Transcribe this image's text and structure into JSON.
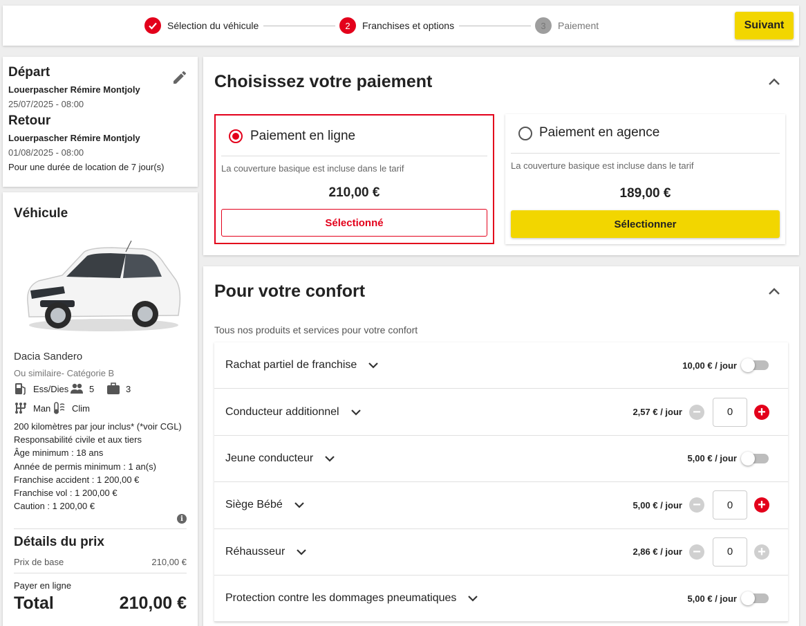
{
  "stepper": {
    "steps": [
      {
        "label": "Sélection du véhicule",
        "state": "done",
        "number": "✓"
      },
      {
        "label": "Franchises et options",
        "state": "active",
        "number": "2"
      },
      {
        "label": "Paiement",
        "state": "todo",
        "number": "3"
      }
    ],
    "next_label": "Suivant"
  },
  "trip": {
    "departure_title": "Départ",
    "departure_place": "Louerpascher Rémire Montjoly",
    "departure_date": "25/07/2025 - 08:00",
    "return_title": "Retour",
    "return_place": "Louerpascher Rémire Montjoly",
    "return_date": "01/08/2025 - 08:00",
    "duration": "Pour une durée de location de 7 jour(s)"
  },
  "vehicle": {
    "title": "Véhicule",
    "name": "Dacia Sandero",
    "similar": "Ou similaire- Catégorie B",
    "fuel": "Ess/Dies",
    "seats": "5",
    "bags": "3",
    "gearbox": "Man",
    "ac": "Clim",
    "info_lines": [
      "200 kilomètres par jour inclus* (*voir CGL)",
      "Responsabilité civile et aux tiers",
      "Âge minimum : 18 ans",
      "Année de permis minimum : 1 an(s)",
      "Franchise accident : 1 200,00 €",
      "Franchise vol : 1 200,00 €",
      "Caution : 1 200,00 €"
    ],
    "info_icon": "i"
  },
  "price": {
    "title": "Détails du prix",
    "base_label": "Prix de base",
    "base_value": "210,00 €",
    "pay_mode": "Payer en ligne",
    "total_label": "Total",
    "total_value": "210,00 €"
  },
  "payment": {
    "title": "Choisissez votre paiement",
    "online": {
      "name": "Paiement en ligne",
      "note": "La couverture basique est incluse dans le tarif",
      "price": "210,00 €",
      "button": "Sélectionné"
    },
    "agency": {
      "name": "Paiement en agence",
      "note": "La couverture basique est incluse dans le tarif",
      "price": "189,00 €",
      "button": "Sélectionner"
    }
  },
  "comfort": {
    "title": "Pour votre confort",
    "subtitle": "Tous nos produits et services pour votre confort",
    "options": [
      {
        "label": "Rachat partiel de franchise",
        "price": "10,00 € / jour",
        "control": "toggle"
      },
      {
        "label": "Conducteur additionnel",
        "price": "2,57 € / jour",
        "control": "stepper",
        "qty": "0",
        "plus_enabled": true
      },
      {
        "label": "Jeune conducteur",
        "price": "5,00 € / jour",
        "control": "toggle"
      },
      {
        "label": "Siège Bébé",
        "price": "5,00 € / jour",
        "control": "stepper",
        "qty": "0",
        "plus_enabled": true
      },
      {
        "label": "Réhausseur",
        "price": "2,86 € / jour",
        "control": "stepper",
        "qty": "0",
        "plus_enabled": false
      },
      {
        "label": "Protection contre les dommages pneumatiques",
        "price": "5,00 € / jour",
        "control": "toggle"
      }
    ]
  },
  "colors": {
    "accent": "#e3001b",
    "button_yellow": "#f2d600",
    "step_inactive": "#9e9e9e"
  }
}
